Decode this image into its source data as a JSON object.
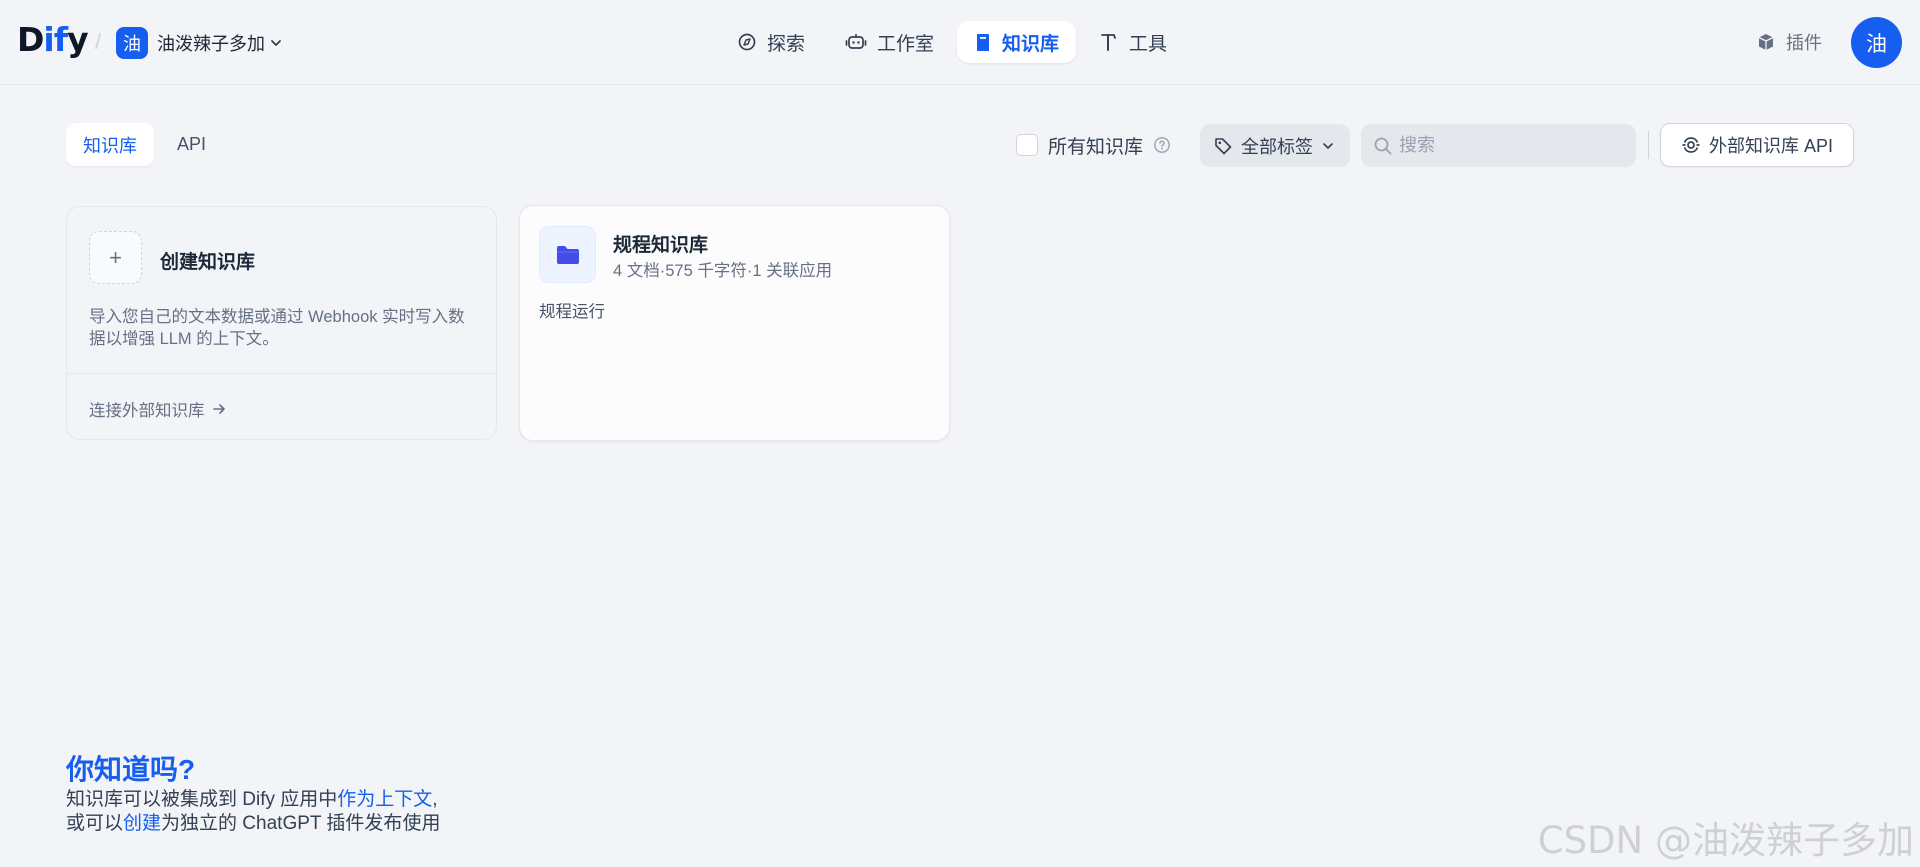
{
  "header": {
    "logo": {
      "pre": "D",
      "accent": "if",
      "post": "y"
    },
    "slash": "/",
    "workspace": {
      "avatar": "油",
      "name": "油泼辣子多加"
    },
    "nav": [
      {
        "label": "探索",
        "icon": "compass-icon"
      },
      {
        "label": "工作室",
        "icon": "robot-icon"
      },
      {
        "label": "知识库",
        "icon": "book-icon",
        "active": true
      },
      {
        "label": "工具",
        "icon": "hammer-icon"
      }
    ],
    "plugins_label": "插件",
    "user_avatar": "油"
  },
  "toolbar": {
    "tabs": [
      {
        "label": "知识库",
        "active": true
      },
      {
        "label": "API",
        "active": false
      }
    ],
    "all_kb_label": "所有知识库",
    "tag_filter_label": "全部标签",
    "search_placeholder": "搜索",
    "external_api_label": "外部知识库 API"
  },
  "create_card": {
    "plus": "+",
    "title": "创建知识库",
    "description": "导入您自己的文本数据或通过 Webhook 实时写入数据以增强 LLM 的上下文。",
    "connect_link": "连接外部知识库"
  },
  "knowledge_bases": [
    {
      "name": "规程知识库",
      "meta": "4 文档·575 千字符·1 关联应用",
      "description": "规程运行"
    }
  ],
  "tip": {
    "title": "你知道吗?",
    "line1_pre": "知识库可以被集成到 Dify 应用中",
    "line1_link": "作为上下文",
    "line1_post": ",",
    "line2_pre": "或可以",
    "line2_link": "创建",
    "line2_post": "为独立的 ChatGPT 插件发布使用"
  },
  "watermark": "CSDN @油泼辣子多加",
  "colors": {
    "accent": "#155eef",
    "background": "#f2f4f7",
    "kb_icon": "#444ce7"
  }
}
